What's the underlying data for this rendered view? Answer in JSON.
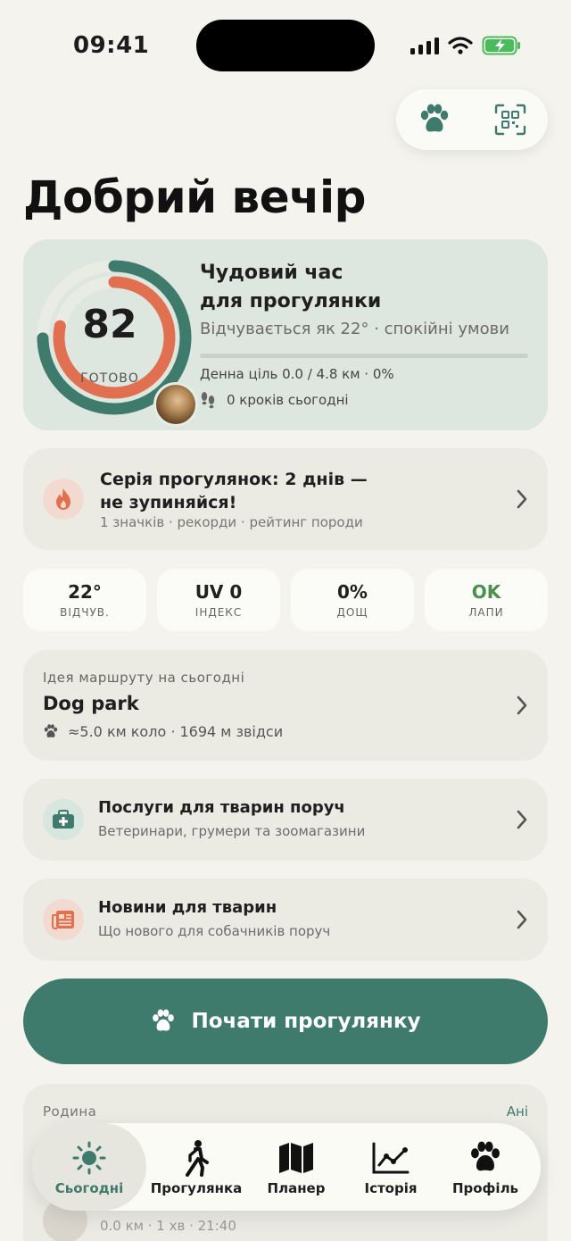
{
  "status": {
    "time": "09:41"
  },
  "greeting": "Добрий вечір",
  "hero": {
    "score": "82",
    "score_label": "ГОТОВО",
    "title_line1": "Чудовий час",
    "title_line2": "для прогулянки",
    "subtitle": "Відчувається як 22° · спокійні умови",
    "goal": "Денна ціль 0.0 / 4.8 км · 0%",
    "goal_progress": 0,
    "steps": "0 кроків сьогодні"
  },
  "streak": {
    "title_line1": "Серія прогулянок: 2 днів —",
    "title_line2": "не зупиняйся!",
    "subtitle": "1 значків · рекорди · рейтинг породи"
  },
  "tiles": [
    {
      "value": "22°",
      "label": "ВІДЧУВ."
    },
    {
      "value": "UV 0",
      "label": "ІНДЕКС"
    },
    {
      "value": "0%",
      "label": "ДОЩ"
    },
    {
      "value": "OK",
      "label": "ЛАПИ"
    }
  ],
  "route": {
    "kicker": "Ідея маршруту на сьогодні",
    "title": "Dog park",
    "meta": "≈5.0 км коло · 1694 м звідси"
  },
  "services": {
    "title": "Послуги для тварин поруч",
    "subtitle": "Ветеринари, грумери та зоомагазини"
  },
  "news": {
    "title": "Новини для тварин",
    "subtitle": "Що нового для собачників поруч"
  },
  "start_button": "Почати прогулянку",
  "family": {
    "title": "Родина",
    "all": "Ані",
    "row": "0.0 км · 1 хв · 21:40"
  },
  "tabs": [
    {
      "label": "Сьогодні",
      "icon": "sun-icon"
    },
    {
      "label": "Прогулянка",
      "icon": "walker-icon"
    },
    {
      "label": "Планер",
      "icon": "map-icon"
    },
    {
      "label": "Історія",
      "icon": "chart-icon"
    },
    {
      "label": "Профіль",
      "icon": "paw-icon"
    }
  ],
  "colors": {
    "accent": "#3f7b6c",
    "orange": "#e0704f",
    "background": "#f4f3ee",
    "hero_bg": "#dde6df",
    "ok_green": "#4a8f4a"
  }
}
